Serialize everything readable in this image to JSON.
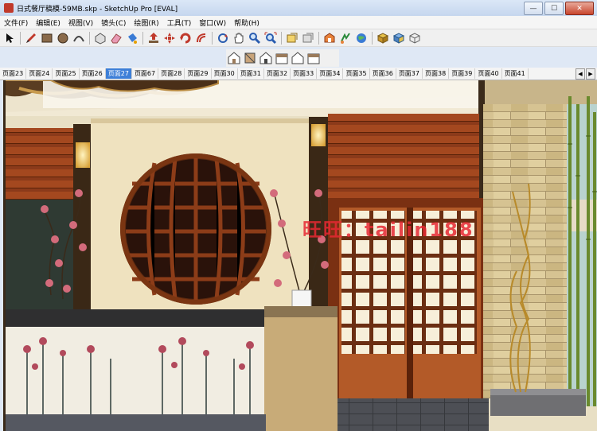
{
  "window": {
    "title": "日式餐厅稿模-59MB.skp - SketchUp Pro [EVAL]",
    "buttons": {
      "minimize": "—",
      "maximize": "☐",
      "close": "✕"
    }
  },
  "menu": [
    "文件(F)",
    "编辑(E)",
    "视图(V)",
    "镜头(C)",
    "绘图(R)",
    "工具(T)",
    "窗口(W)",
    "帮助(H)"
  ],
  "toolbar_main": [
    "select-icon",
    "pencil-icon",
    "rectangle-icon",
    "circle-icon",
    "arc-icon",
    "make-component-icon",
    "eraser-icon",
    "paint-bucket-icon",
    "push-pull-icon",
    "move-icon",
    "rotate-icon",
    "offset-icon",
    "orbit-icon",
    "pan-icon",
    "zoom-icon",
    "zoom-extents-icon",
    "previous-view-icon",
    "next-view-icon",
    "3d-warehouse-icon",
    "share-model-icon",
    "google-earth-icon",
    "get-models-icon",
    "share-component-icon",
    "extension-icon"
  ],
  "toolbar_views": [
    "iso-view-icon",
    "top-view-icon",
    "front-view-icon",
    "right-view-icon",
    "back-view-icon",
    "left-view-icon"
  ],
  "scene_tabs": [
    "页面23",
    "页面24",
    "页面25",
    "页面26",
    "页面27",
    "页面67",
    "页面28",
    "页面29",
    "页面30",
    "页面31",
    "页面32",
    "页面33",
    "页面34",
    "页面35",
    "页面36",
    "页面37",
    "页面38",
    "页面39",
    "页面40",
    "页面41"
  ],
  "active_tab": "页面27",
  "watermark": "旺旺：tailin188",
  "colors": {
    "wood": "#8b3a1a",
    "wood_light": "#b5612f",
    "plaster": "#efe2bf",
    "stone": "#d4c18f",
    "shoji": "#f7efd9",
    "counter_top": "#2a2a2a",
    "accent_tab": "#3d7fd8",
    "watermark": "#e62832"
  }
}
